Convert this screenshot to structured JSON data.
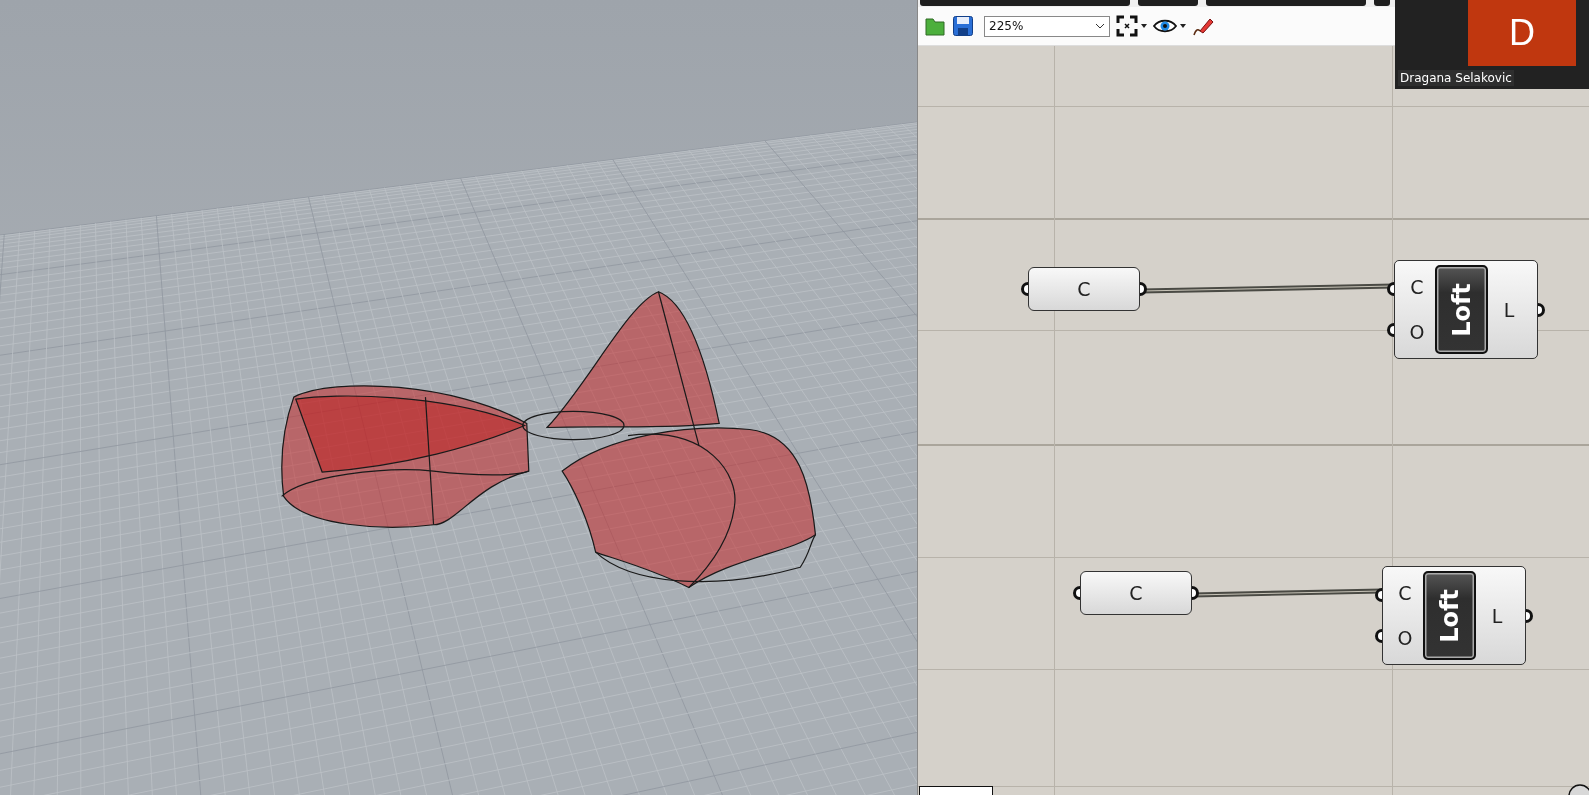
{
  "toolbar": {
    "zoom": "225%"
  },
  "groups": [
    {
      "param": {
        "label": "C"
      },
      "component": {
        "title": "Loft",
        "inputs": [
          "C",
          "O"
        ],
        "outputs": [
          "L"
        ]
      }
    },
    {
      "param": {
        "label": "C"
      },
      "component": {
        "title": "Loft",
        "inputs": [
          "C",
          "O"
        ],
        "outputs": [
          "L"
        ]
      }
    }
  ],
  "participant": {
    "initial": "D",
    "name": "Dragana Selakovic"
  }
}
